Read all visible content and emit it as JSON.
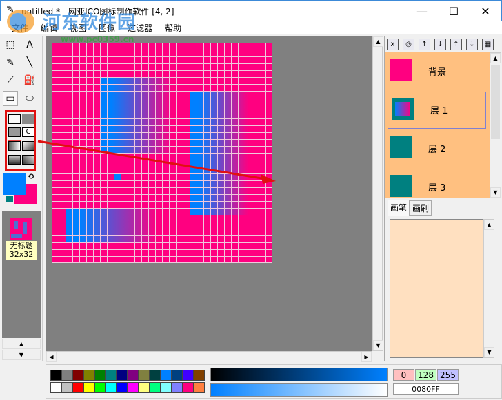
{
  "window": {
    "title": "untitled * - 网亚ICO图标制作软件 [4, 2]",
    "minimize": "—",
    "maximize": "☐",
    "close": "✕"
  },
  "watermark": {
    "name": "河东软件园",
    "url": "www.pc0359.cn"
  },
  "menu": [
    "文件",
    "编辑",
    "视图",
    "图像",
    "过滤器",
    "帮助"
  ],
  "tools": [
    {
      "icon": "select-rect-icon",
      "glyph": "⬚"
    },
    {
      "icon": "text-icon",
      "glyph": "A"
    },
    {
      "icon": "pencil-icon",
      "glyph": "✎"
    },
    {
      "icon": "line-icon",
      "glyph": "╲"
    },
    {
      "icon": "eyedropper-icon",
      "glyph": "⟋"
    },
    {
      "icon": "fill-bucket-icon",
      "glyph": "⛽"
    },
    {
      "icon": "rectangle-icon",
      "glyph": "▭"
    },
    {
      "icon": "ellipse-icon",
      "glyph": "⬭"
    }
  ],
  "fill_modes": {
    "c_label": "C"
  },
  "colors": {
    "primary": "#0080ff",
    "secondary": "#ff0080",
    "transparent": "#008080",
    "swap_glyph": "⟲"
  },
  "icon_list": [
    {
      "name": "无标题",
      "size": "32x32"
    }
  ],
  "canvas": {
    "grid_size": 32,
    "background": "#ff0080",
    "gradient_from": "#0080ff",
    "gradient_to": "#ff0080",
    "grid_line": "#f0c8dc"
  },
  "layer_toolbar": [
    {
      "icon": "delete-layer-icon",
      "glyph": "x"
    },
    {
      "icon": "visibility-icon",
      "glyph": "◎"
    },
    {
      "icon": "move-up-icon",
      "glyph": "↑"
    },
    {
      "icon": "move-down-icon",
      "glyph": "↓"
    },
    {
      "icon": "merge-up-icon",
      "glyph": "⇡"
    },
    {
      "icon": "merge-down-icon",
      "glyph": "⇣"
    },
    {
      "icon": "flatten-icon",
      "glyph": "▦"
    }
  ],
  "layers": [
    {
      "label": "背景",
      "color": "#ff0080"
    },
    {
      "label": "层 1",
      "color": "#008080",
      "selected": true
    },
    {
      "label": "层 2",
      "color": "#008080"
    },
    {
      "label": "层 3",
      "color": "#008080"
    }
  ],
  "tabs": [
    "画笔",
    "画刷"
  ],
  "palette": {
    "top": [
      "#000000",
      "#808080",
      "#800000",
      "#808000",
      "#008000",
      "#008080",
      "#000080",
      "#800080",
      "#808040",
      "#004040",
      "#0080ff",
      "#004080",
      "#4000ff",
      "#804000"
    ],
    "bottom": [
      "#ffffff",
      "#c0c0c0",
      "#ff0000",
      "#ffff00",
      "#00ff00",
      "#00ffff",
      "#0000ff",
      "#ff00ff",
      "#ffff80",
      "#00ff80",
      "#80ffff",
      "#8080ff",
      "#ff0080",
      "#ff8040"
    ]
  },
  "rgb": {
    "r": "0",
    "g": "128",
    "b": "255",
    "hex": "0080FF"
  }
}
